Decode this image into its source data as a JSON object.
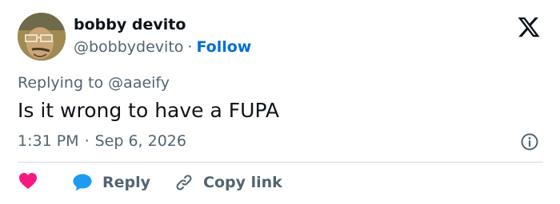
{
  "author": {
    "display_name": "bobby devito",
    "handle": "@bobbydevito",
    "separator": "·",
    "follow_label": "Follow"
  },
  "reply_context": {
    "prefix": "Replying to",
    "mention": "@aaeify"
  },
  "tweet": {
    "text": "Is it wrong to have a FUPA",
    "time": "1:31 PM",
    "separator": "·",
    "date": "Sep 6, 2026"
  },
  "actions": {
    "reply_label": "Reply",
    "copy_link_label": "Copy link"
  },
  "icons": {
    "brand": "x-logo-icon",
    "info": "info-icon",
    "like": "heart-icon",
    "reply": "speech-bubble-icon",
    "copy": "link-icon"
  },
  "colors": {
    "text_primary": "#0f1419",
    "text_secondary": "#536471",
    "link_blue": "#006fd6",
    "heart_pink": "#f91880",
    "reply_blue": "#1d9bf0",
    "divider": "#cfd9de"
  }
}
